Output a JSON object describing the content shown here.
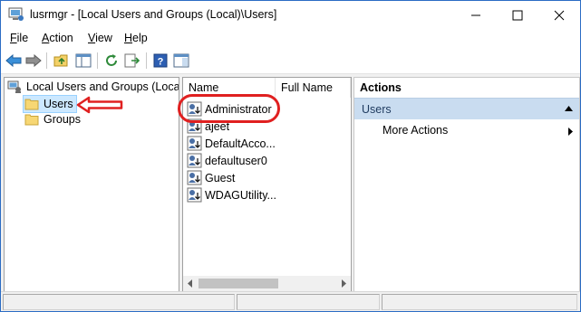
{
  "window": {
    "title": "lusrmgr - [Local Users and Groups (Local)\\Users]"
  },
  "menu": [
    {
      "label": "File",
      "key": "F",
      "rest": "ile"
    },
    {
      "label": "Action",
      "key": "A",
      "rest": "ction"
    },
    {
      "label": "View",
      "key": "V",
      "rest": "iew"
    },
    {
      "label": "Help",
      "key": "H",
      "rest": "elp"
    }
  ],
  "tree": {
    "root": "Local Users and Groups (Local)",
    "items": [
      {
        "label": "Users",
        "selected": true
      },
      {
        "label": "Groups",
        "selected": false
      }
    ]
  },
  "list": {
    "columns": [
      "Name",
      "Full Name"
    ],
    "rows": [
      "Administrator",
      "ajeet",
      "DefaultAcco...",
      "defaultuser0",
      "Guest",
      "WDAGUtility..."
    ]
  },
  "actions": {
    "header": "Actions",
    "section": "Users",
    "items": [
      "More Actions"
    ]
  },
  "colors": {
    "annotation": "#e02020",
    "selection": "#cce8ff",
    "actions_bar": "#c9dcf0"
  }
}
